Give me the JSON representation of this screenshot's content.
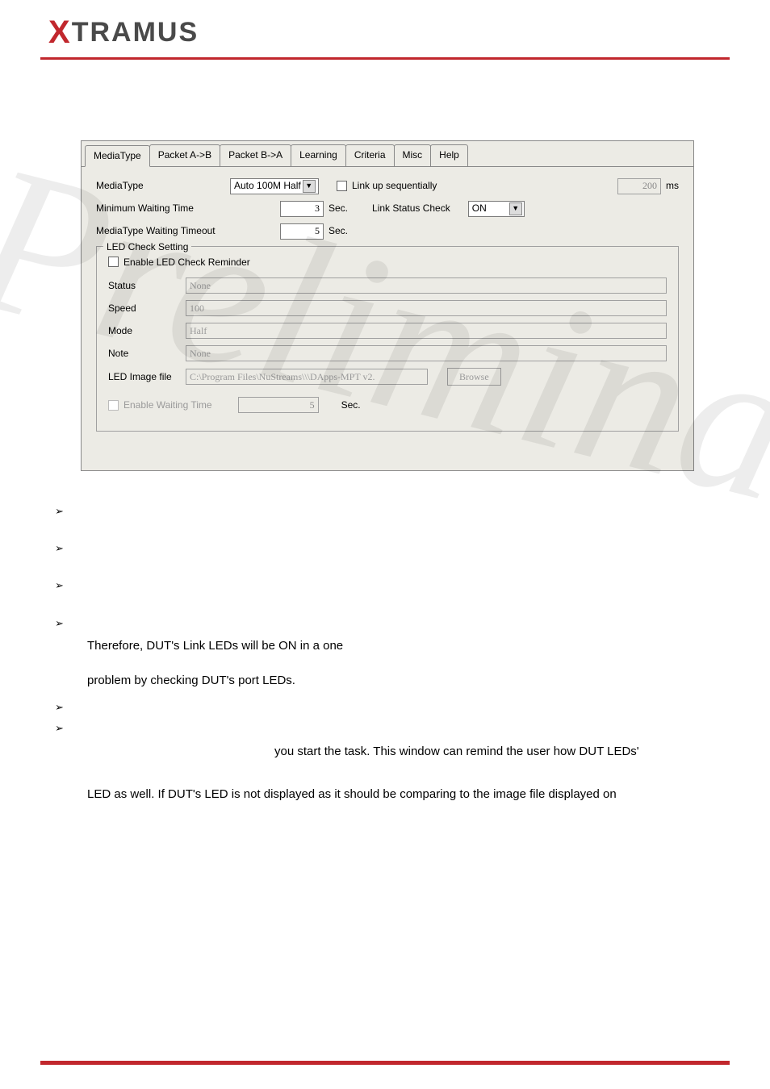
{
  "logo": {
    "x": "X",
    "rest": "TRAMUS"
  },
  "tabs": [
    "MediaType",
    "Packet A->B",
    "Packet B->A",
    "Learning",
    "Criteria",
    "Misc",
    "Help"
  ],
  "form": {
    "mediaType_lbl": "MediaType",
    "mediaType_val": "Auto 100M Half",
    "linkUpSeq_lbl": "Link up sequentially",
    "linkUpSeq_val": "200",
    "linkUpSeq_unit": "ms",
    "minWait_lbl": "Minimum Waiting Time",
    "minWait_val": "3",
    "sec": "Sec.",
    "linkStatus_lbl": "Link Status Check",
    "linkStatus_val": "ON",
    "mediaTimeout_lbl": "MediaType Waiting Timeout",
    "mediaTimeout_val": "5"
  },
  "led": {
    "group_title": "LED Check Setting",
    "enable_lbl": "Enable LED Check Reminder",
    "status_lbl": "Status",
    "status_val": "None",
    "speed_lbl": "Speed",
    "speed_val": "100",
    "mode_lbl": "Mode",
    "mode_val": "Half",
    "note_lbl": "Note",
    "note_val": "None",
    "image_lbl": "LED Image file",
    "image_val": "C:\\Program Files\\NuStreams\\\\\\DApps-MPT v2.",
    "browse": "Browse",
    "enableWait_lbl": "Enable Waiting Time",
    "enableWait_val": "5",
    "enableWait_unit": "Sec."
  },
  "body": {
    "line1": "Therefore, DUT's Link LEDs will be ON in a one",
    "line2": "problem by checking DUT's port LEDs.",
    "line3": "you start the task. This window can remind the user how DUT LEDs'",
    "line4": "LED as well. If DUT's LED is not displayed as it should be comparing to the image file displayed on"
  },
  "watermark": "Preliminary",
  "chev": "➢"
}
